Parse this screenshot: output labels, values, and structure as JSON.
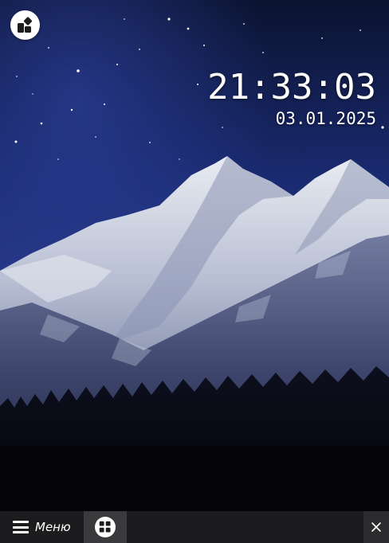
{
  "clock": {
    "time": "21:33:03",
    "date": "03.01.2025"
  },
  "desktop": {
    "widget_button_icon": "widgets-icon"
  },
  "taskbar": {
    "menu_icon": "hamburger-icon",
    "menu_label": "Меню",
    "running_app_icon": "widgets-icon",
    "close_icon": "close-icon"
  },
  "colors": {
    "sky_top": "#0b1330",
    "sky_mid": "#1f2f7a",
    "snow": "#d7dbe6",
    "taskbar": "#1c1c1e",
    "taskbar_active": "#3a3a3c"
  }
}
